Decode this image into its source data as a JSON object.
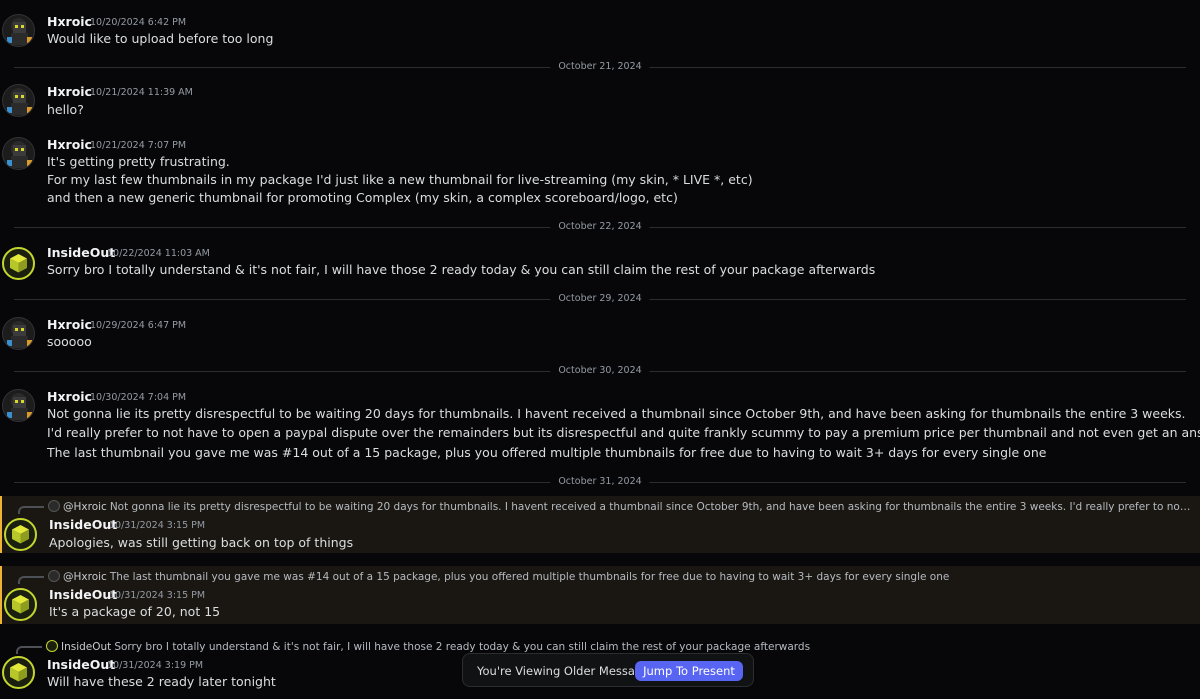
{
  "messages": [
    {
      "author": "Hxroic",
      "time": "10/20/2024 6:42 PM",
      "lines": [
        "Would like to upload before too long"
      ]
    },
    {
      "author": "Hxroic",
      "time": "10/21/2024 11:39 AM",
      "lines": [
        "hello?"
      ]
    },
    {
      "author": "Hxroic",
      "time": "10/21/2024 7:07 PM",
      "lines": [
        "It's getting pretty frustrating.",
        "For my last few thumbnails in my package I'd just like a new thumbnail for live-streaming (my skin, * LIVE *, etc)",
        "and then a new generic thumbnail for promoting Complex (my skin, a complex scoreboard/logo, etc)"
      ]
    },
    {
      "author": "InsideOut",
      "time": "10/22/2024 11:03 AM",
      "lines": [
        "Sorry bro I totally understand & it's not fair, I will have those 2 ready today & you can still claim the rest of your package afterwards"
      ]
    },
    {
      "author": "Hxroic",
      "time": "10/29/2024 6:47 PM",
      "lines": [
        "sooooo"
      ]
    },
    {
      "author": "Hxroic",
      "time": "10/30/2024 7:04 PM",
      "lines": [
        "Not gonna lie its pretty disrespectful to be waiting 20 days for thumbnails. I havent received a thumbnail since October 9th, and have been asking for thumbnails the entire 3 weeks.",
        "I'd really prefer to not have to open a paypal dispute over the remainders but its disrespectful and quite frankly scummy to pay a premium price per thumbnail and not even get an answer back.",
        "The last thumbnail you gave me was #14 out of a 15 package, plus you offered multiple thumbnails for free due to having to wait 3+ days for every single one"
      ]
    },
    {
      "author": "InsideOut",
      "time": "10/31/2024 3:15 PM",
      "reply_author": "@Hxroic",
      "reply_text": "Not gonna lie its pretty disrespectful to be waiting 20 days for thumbnails. I havent received a thumbnail since October 9th, and have been asking for thumbnails the entire 3 weeks. I'd really prefer to not have to open a paypal di...",
      "lines": [
        "Apologies, was still getting back on top of things"
      ]
    },
    {
      "author": "InsideOut",
      "time": "10/31/2024 3:15 PM",
      "reply_author": "@Hxroic",
      "reply_text": "The last thumbnail you gave me was #14 out of a 15 package, plus you offered multiple thumbnails for free due to having to wait 3+ days for every single one",
      "lines": [
        "It's a package of 20, not 15"
      ]
    },
    {
      "author": "InsideOut",
      "time": "10/31/2024 3:19 PM",
      "reply_author": "InsideOut",
      "reply_text": "Sorry bro I totally understand & it's not fair, I will have those 2 ready today & you can still claim the rest of your package afterwards",
      "lines": [
        "Will have these 2 ready later tonight"
      ]
    }
  ],
  "dividers": [
    "October 21, 2024",
    "October 22, 2024",
    "October 29, 2024",
    "October 30, 2024",
    "October 31, 2024"
  ],
  "toast": {
    "text": "You're Viewing Older Messages",
    "button": "Jump To Present"
  },
  "colors": {
    "background": "#070709",
    "accent": "#5865f2",
    "mention_bar": "#f0b232",
    "insideout_ring": "#c4d62e"
  },
  "icons": {
    "hxroic_avatar": "hxroic-avatar-icon",
    "insideout_avatar": "insideout-cube-icon"
  }
}
